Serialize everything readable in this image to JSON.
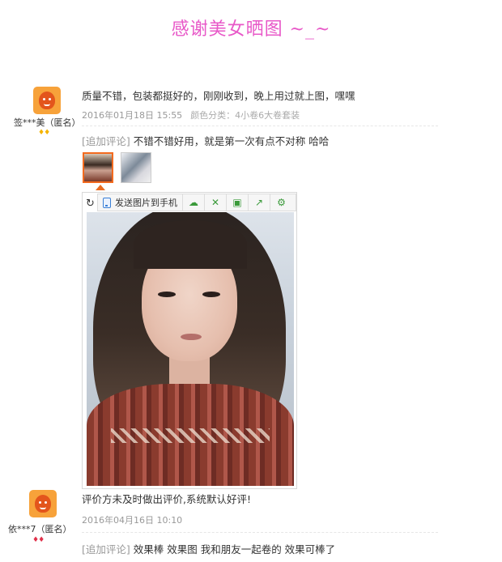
{
  "banner": {
    "text": "感谢美女晒图 ~_~"
  },
  "reviews": [
    {
      "username": "签***美（匿名）",
      "badge": "♦♦",
      "badge_color": "#f5b400",
      "content": "质量不错，包装都挺好的，刚刚收到，晚上用过就上图，嘿嘿",
      "date": "2016年01月18日 15:55",
      "category": "颜色分类：4小卷6大卷套装",
      "append_tag": "[追加评论]",
      "append_text": "不错不错好用，就是第一次有点不对称 哈哈"
    },
    {
      "username": "依***7（匿名）",
      "badge": "♦♦",
      "badge_color": "#e0304a",
      "content": "评价方未及时做出评价,系统默认好评!",
      "date": "2016年04月16日 10:10",
      "append_tag": "[追加评论]",
      "append_text": "效果棒 效果图 我和朋友一起卷的 效果可棒了"
    }
  ],
  "viewer": {
    "rotate_icon": "↻",
    "send_label": "发送图片到手机",
    "tools": [
      {
        "icon": "cloud-icon",
        "glyph": "☁"
      },
      {
        "icon": "expand-icon",
        "glyph": "✕"
      },
      {
        "icon": "save-icon",
        "glyph": "▣"
      },
      {
        "icon": "share-icon",
        "glyph": "↗"
      },
      {
        "icon": "settings-icon",
        "glyph": "⚙"
      }
    ]
  }
}
